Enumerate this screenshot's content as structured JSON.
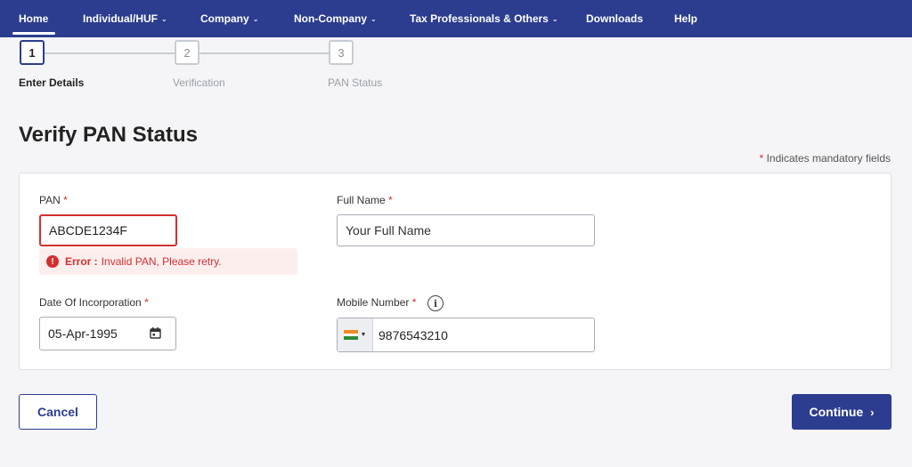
{
  "nav": {
    "items": [
      {
        "label": "Home",
        "dropdown": false
      },
      {
        "label": "Individual/HUF",
        "dropdown": true
      },
      {
        "label": "Company",
        "dropdown": true
      },
      {
        "label": "Non-Company",
        "dropdown": true
      },
      {
        "label": "Tax Professionals & Others",
        "dropdown": true
      },
      {
        "label": "Downloads",
        "dropdown": false
      },
      {
        "label": "Help",
        "dropdown": false
      }
    ],
    "chevron": "⌄"
  },
  "stepper": {
    "steps": [
      {
        "number": "1",
        "label": "Enter Details",
        "active": true
      },
      {
        "number": "2",
        "label": "Verification",
        "active": false
      },
      {
        "number": "3",
        "label": "PAN Status",
        "active": false
      }
    ]
  },
  "page": {
    "title": "Verify PAN Status",
    "mandatory_marker": "*",
    "mandatory_note": "Indicates mandatory fields"
  },
  "form": {
    "pan": {
      "label": "PAN",
      "value": "ABCDE1234F"
    },
    "error": {
      "prefix": "Error :",
      "message": "Invalid PAN, Please retry.",
      "icon": "!"
    },
    "full_name": {
      "label": "Full Name",
      "placeholder": "Your Full Name"
    },
    "doi": {
      "label": "Date Of Incorporation",
      "value": "05-Apr-1995"
    },
    "mobile": {
      "label": "Mobile Number",
      "value": "9876543210",
      "info_icon": "i"
    }
  },
  "actions": {
    "cancel_label": "Cancel",
    "continue_label": "Continue",
    "continue_arrow": "›"
  },
  "colors": {
    "primary": "#2c3d8f",
    "error": "#d32f2f",
    "error_bg": "#fdeeee"
  }
}
